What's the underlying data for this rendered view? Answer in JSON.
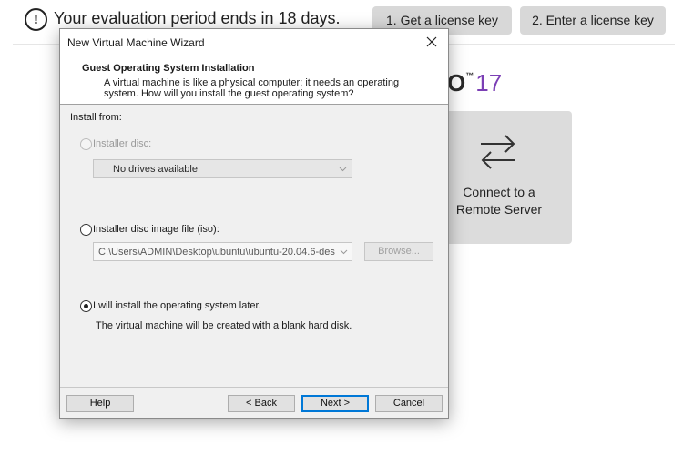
{
  "banner": {
    "warning_icon": "!",
    "eval_text": "Your evaluation period ends in 18 days.",
    "license_btn_1": "1. Get a license key",
    "license_btn_2": "2. Enter a license key"
  },
  "home": {
    "logo_fragment": "O",
    "logo_tm": "™",
    "logo_version": "17",
    "remote_tile": {
      "icon": "swap-arrows-icon",
      "label": "Connect to a Remote Server"
    }
  },
  "dialog": {
    "title": "New Virtual Machine Wizard",
    "header_title": "Guest Operating System Installation",
    "header_desc": "A virtual machine is like a physical computer; it needs an operating system. How will you install the guest operating system?",
    "install_from": "Install from:",
    "option_disc": {
      "label": "Installer disc:",
      "enabled": false,
      "selected": false
    },
    "disc_combo": "No drives available",
    "option_iso": {
      "label": "Installer disc image file (iso):",
      "enabled": true,
      "selected": false
    },
    "iso_path": "C:\\Users\\ADMIN\\Desktop\\ubuntu\\ubuntu-20.04.6-des",
    "browse": "Browse...",
    "option_later": {
      "label": "I will install the operating system later.",
      "enabled": true,
      "selected": true
    },
    "later_note": "The virtual machine will be created with a blank hard disk.",
    "buttons": {
      "help": "Help",
      "back": "< Back",
      "next": "Next >",
      "cancel": "Cancel"
    }
  }
}
